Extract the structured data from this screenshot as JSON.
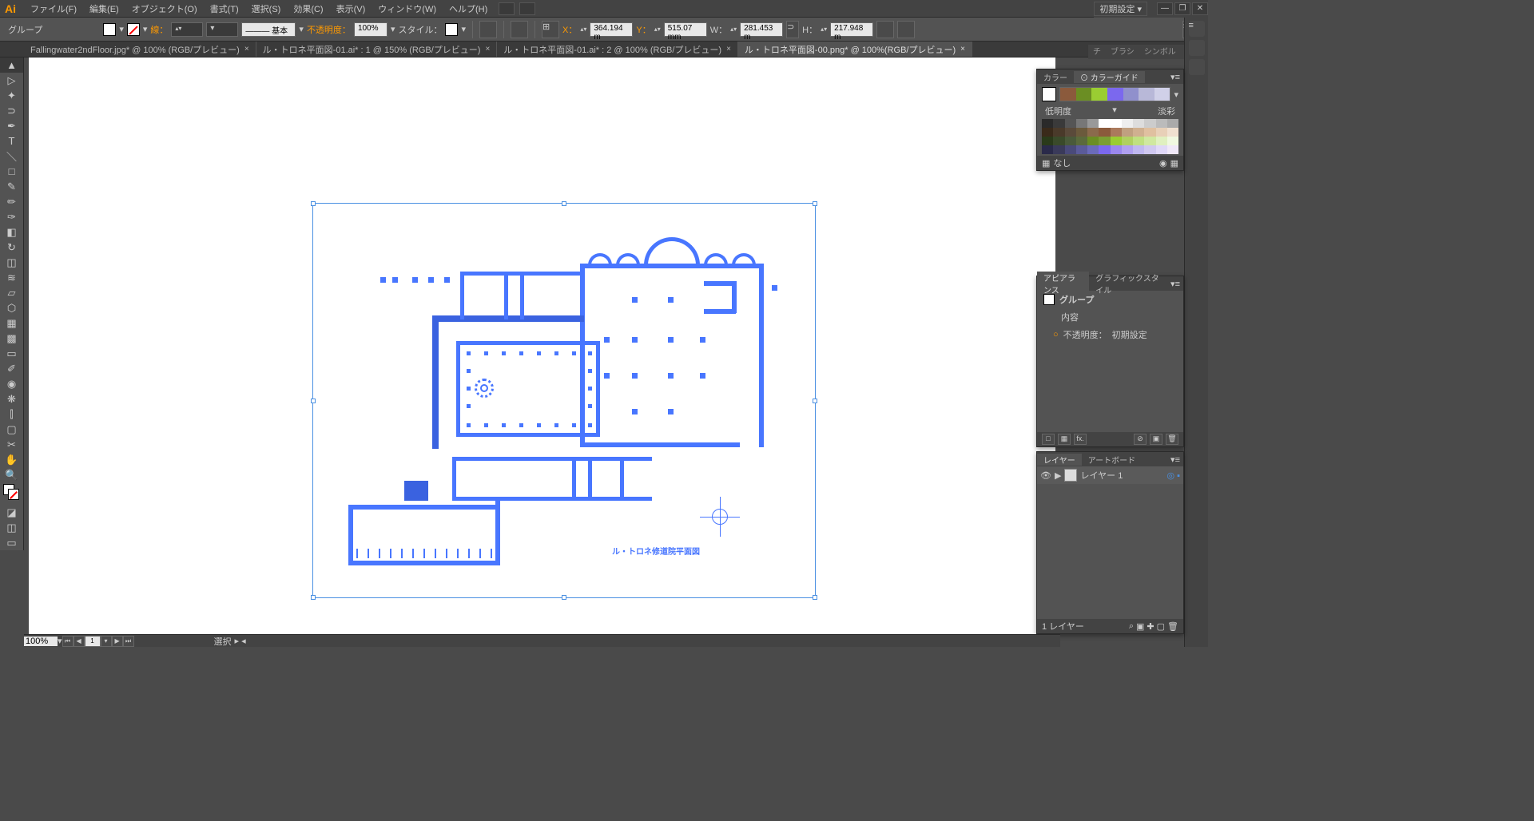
{
  "app": {
    "logo": "Ai"
  },
  "menu": {
    "file": "ファイル(F)",
    "edit": "編集(E)",
    "object": "オブジェクト(O)",
    "format": "書式(T)",
    "select": "選択(S)",
    "effect": "効果(C)",
    "view": "表示(V)",
    "window": "ウィンドウ(W)",
    "help": "ヘルプ(H)"
  },
  "workspace": {
    "label": "初期設定 ▾"
  },
  "control": {
    "selection": "グループ",
    "stroke_label": "線：",
    "stroke_weight": "",
    "stroke_style": "――― 基本",
    "opacity_label": "不透明度：",
    "opacity_value": "100%",
    "style_label": "スタイル：",
    "x_label": "X：",
    "x_value": "364.194 m",
    "y_label": "Y：",
    "y_value": "515.07 mm",
    "w_label": "W：",
    "w_value": "281.453 m",
    "h_label": "H：",
    "h_value": "217.948 m"
  },
  "tabs": [
    {
      "label": "Fallingwater2ndFloor.jpg* @ 100% (RGB/プレビュー)",
      "active": false
    },
    {
      "label": "ル・トロネ平面図-01.ai* : 1 @ 150% (RGB/プレビュー)",
      "active": false
    },
    {
      "label": "ル・トロネ平面図-01.ai* : 2 @ 100% (RGB/プレビュー)",
      "active": false
    },
    {
      "label": "ル・トロネ平面図-00.png* @ 100%(RGB/プレビュー)",
      "active": true
    }
  ],
  "brush_tabs": {
    "a": "チ",
    "b": "ブラシ",
    "c": "シンボル"
  },
  "color_panel": {
    "tab1": "カラー",
    "tab2": "⊙ カラーガイド",
    "low_label": "低明度",
    "high_label": "淡彩",
    "none_label": "なし"
  },
  "appearance": {
    "tab1": "アピアランス",
    "tab2": "グラフィックスタイル",
    "type": "グループ",
    "contents": "内容",
    "opacity_label": "不透明度：",
    "opacity_value": "初期設定",
    "fx": "fx."
  },
  "layers": {
    "tab1": "レイヤー",
    "tab2": "アートボード",
    "layer1": "レイヤー 1",
    "count": "1 レイヤー"
  },
  "status": {
    "zoom": "100%",
    "artboard": "1",
    "selection": "選択"
  },
  "floorplan": {
    "caption": "ル・トロネ修道院平面図"
  }
}
